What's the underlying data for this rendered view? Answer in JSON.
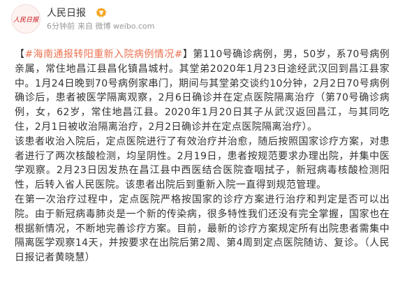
{
  "author": {
    "name": "人民日报",
    "avatar_text": "人民日报",
    "badge_icon": "verified-badge-icon",
    "badge_color": "#f5a623"
  },
  "post_meta": {
    "time": "6分钟前",
    "source": "来自 微博 weibo.com"
  },
  "post": {
    "bracket_open": "【",
    "topic": "#海南通报转阳重新入院病例情况#",
    "bracket_close": "】",
    "paragraph_1": "第110号确诊病例，男，50岁，系70号病例亲属，常住地昌江县昌化镇昌城村。其堂弟2020年1月23日途经武汉回到昌江县家中。1月24日晚到70号病例家串门，期间与其堂弟交谈约10分钟，2月2日70号病例确诊后，患者被医学隔离观察，2月6日确诊并在定点医院隔离治疗（第70号确诊病例，女，62岁，常住地昌江县。2020年1月20日其子从武汉返回昌江，与其同吃住，2月1日被收治隔离治疗，2月2日确诊并在定点医院隔离治疗）。",
    "paragraph_2": "该患者收治入院后，定点医院进行了有效治疗并治愈，随后按照国家诊疗方案，对患者进行了两次核酸检测，均呈阴性。2月19日，患者按规范要求办理出院，并集中医学观察。2月23日因发热在昌江县中西医结合医院查咽拭子，新冠病毒核酸检测阳性，后转入省人民医院。该患者出院后到重新入院一直得到规范管理。",
    "paragraph_3": "在第一次治疗过程中，定点医院严格按国家的诊疗方案进行治疗和判定是否可以出院。由于新冠病毒肺炎是一个新的传染病，很多特性我们还没有完全掌握，国家也在根据新情况，不断地完善诊疗方案。目前，最新的诊疗方案规定所有出院患者需集中隔离医学观察14天，并按要求在出院后第2周、第4周到定点医院随访、复诊。（人民日报记者黄晓慧）"
  },
  "colors": {
    "topic_link": "#eb7350",
    "body_text": "#333333",
    "meta_text": "#999999"
  }
}
